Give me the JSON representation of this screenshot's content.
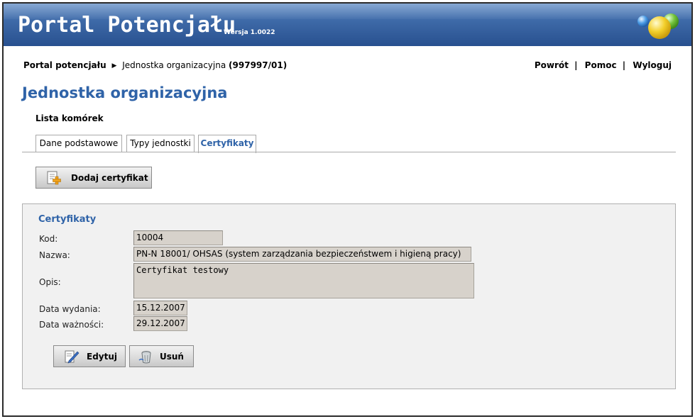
{
  "header": {
    "title": "Portal Potencjału",
    "version": "Wersja 1.0022"
  },
  "breadcrumb": {
    "root": "Portal potencjału",
    "current": "Jednostka organizacyjna",
    "code": "(997997/01)"
  },
  "toplinks": {
    "back": "Powrót",
    "help": "Pomoc",
    "logout": "Wyloguj",
    "separator": "|"
  },
  "page": {
    "title": "Jednostka organizacyjna",
    "subnav": "Lista komórek"
  },
  "tabs": [
    {
      "label": "Dane podstawowe",
      "active": false
    },
    {
      "label": "Typy jednostki",
      "active": false
    },
    {
      "label": "Certyfikaty",
      "active": true
    }
  ],
  "actions": {
    "add_certificate": "Dodaj certyfikat"
  },
  "certificate": {
    "section_title": "Certyfikaty",
    "fields": {
      "code_label": "Kod:",
      "code_value": "10004",
      "name_label": "Nazwa:",
      "name_value": "PN-N 18001/ OHSAS (system zarządzania bezpieczeństwem i higieną pracy)",
      "desc_label": "Opis:",
      "desc_value": "Certyfikat testowy",
      "issue_label": "Data wydania:",
      "issue_value": "15.12.2007",
      "expiry_label": "Data ważności:",
      "expiry_value": "29.12.2007"
    },
    "buttons": {
      "edit": "Edytuj",
      "delete": "Usuń"
    }
  },
  "colors": {
    "header_blue": "#3e6aa8",
    "accent_blue": "#2f63a8",
    "field_bg": "#d7d2cb",
    "panel_bg": "#f1f1f1"
  },
  "icons": {
    "logo": "bubbles-logo-icon",
    "add": "document-add-icon",
    "edit": "pencil-edit-icon",
    "delete": "trash-bin-icon",
    "breadcrumb_separator": "triangle-right-icon"
  }
}
